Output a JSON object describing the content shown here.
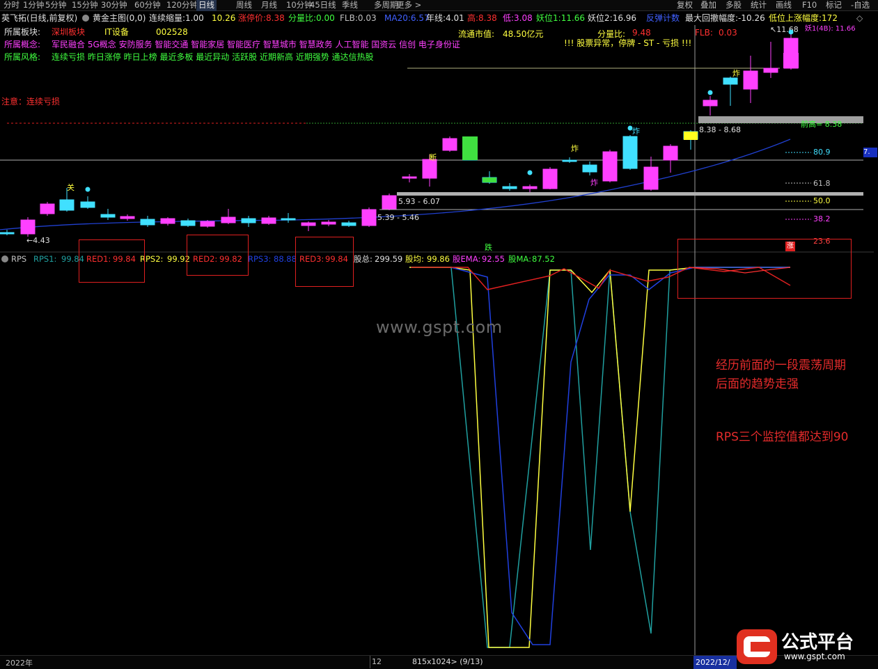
{
  "toolbar": {
    "periods": [
      "分时",
      "1分钟",
      "5分钟",
      "15分钟",
      "30分钟",
      "60分钟",
      "120分钟",
      "日线",
      "周线",
      "月线",
      "10分钟",
      "45日线",
      "季线",
      "多周期",
      "更多 >"
    ],
    "active": "日线",
    "right_buttons": [
      "复权",
      "叠加",
      "多股",
      "统计",
      "画线",
      "F10",
      "标记",
      "-自选"
    ]
  },
  "header": {
    "stock_name": "英飞拓(日线,前复权)",
    "indicator": "黄金主图(0,0)",
    "items": [
      {
        "label": "连续缩量:",
        "value": "1.00",
        "color": "#e0e0e0"
      },
      {
        "label": "",
        "value": "10.26",
        "color": "#ffff40"
      },
      {
        "label": "涨停价:",
        "value": "8.38",
        "color": "#ff3030"
      },
      {
        "label": "分量比:",
        "value": "0.00",
        "color": "#40ff40"
      },
      {
        "label": "FLB:",
        "value": "0.03",
        "color": "#c0c0c0"
      },
      {
        "label": "MA20:",
        "value": "6.57",
        "color": "#4060ff"
      },
      {
        "label": "年线:",
        "value": "4.01",
        "color": "#e0e0e0"
      },
      {
        "label": "高:",
        "value": "8.38",
        "color": "#ff3030"
      },
      {
        "label": "低:",
        "value": "3.08",
        "color": "#ff40ff"
      },
      {
        "label": "妖位1:",
        "value": "11.66",
        "color": "#40ff40"
      },
      {
        "label": "妖位2:",
        "value": "16.96",
        "color": "#e0e0e0"
      },
      {
        "label": "反弹计数",
        "value": "",
        "color": "#4060ff"
      },
      {
        "label": "最大回撤幅度:",
        "value": "-10.26",
        "color": "#e0e0e0"
      },
      {
        "label": "低位上涨幅度:",
        "value": "172",
        "color": "#ffff40"
      }
    ]
  },
  "info": {
    "sector_label": "所属板块:",
    "sector_region": "深圳板块",
    "sector_industry": "IT设备",
    "stock_code": "002528",
    "concept_label": "所属概念:",
    "concepts": "军民融合 5G概念 安防服务 智能交通 智能家居 智能医疗 智慧城市 智慧政务 人工智能 国资云 信创 电子身份证",
    "style_label": "所属风格:",
    "styles": "连续亏损 昨日涨停 昨日上榜 最近多板 最近异动 活跃股 近期新高 近期强势 通达信热股",
    "circ_mv_label": "流通市值:",
    "circ_mv": "48.50亿元",
    "vol_ratio_label": "分量比:",
    "vol_ratio": "9.48",
    "flb_label": "FLB:",
    "flb": "0.03",
    "warning": "!!!  股票异常，停牌 - ST - 亏损  !!!",
    "attention": "注意：连续亏损",
    "peak_label": "↖11.68",
    "peak_suffix": "妖1(4B): 11.66"
  },
  "chart_labels": {
    "low_price": "←4.43",
    "range1": "5.39 - 5.46",
    "range2": "5.93 - 6.07",
    "range3": "8.38 - 8.68",
    "prev_high": "前高= 8.38",
    "lv_808": "80.9",
    "lv_618": "61.8",
    "lv_50": "50.0",
    "lv_382": "38.2",
    "lv_236": "23.6",
    "right_edge": "7.",
    "glyph_guan": "关",
    "glyph_duan": "断",
    "glyph_zha1": "炸",
    "glyph_zha2": "炸",
    "glyph_zha3": "炸",
    "glyph_zha4": "炸",
    "glyph_die": "跌",
    "glyph_zhang": "涨"
  },
  "rps": {
    "name": "RPS",
    "rps1_label": "RPS1:",
    "rps1": "99.84",
    "red1_label": "RED1:",
    "red1": "99.84",
    "rps2_label": "RPS2:",
    "rps2": "99.92",
    "red2_label": "RED2:",
    "red2": "99.82",
    "rps3_label": "RPS3:",
    "rps3": "88.88",
    "red3_label": "RED3:",
    "red3": "99.84",
    "total_label": "股总:",
    "total": "299.59",
    "avg_label": "股均:",
    "avg": "99.86",
    "ema_label": "股EMA:",
    "ema": "92.55",
    "ma_label": "股MA:",
    "ma": "87.52"
  },
  "notes": {
    "line1": "经历前面的一段震荡周期",
    "line2": "后面的趋势走强",
    "line3": "RPS三个监控值都达到90"
  },
  "watermark": {
    "center": "www.gspt.com",
    "logo_text": "公式平台",
    "logo_url": "www.gspt.com"
  },
  "footer": {
    "year_left": "2022年",
    "month": "12",
    "page_info": "815x1024> (9/13)",
    "date_right": "2022/12/"
  },
  "colors": {
    "up": "#ff40ff",
    "down": "#40e0ff",
    "rps1": "#20a0a0",
    "rps2": "#ffff40",
    "rps3": "#2040e0",
    "red": "#e02020",
    "ma20": "#2040d0"
  }
}
